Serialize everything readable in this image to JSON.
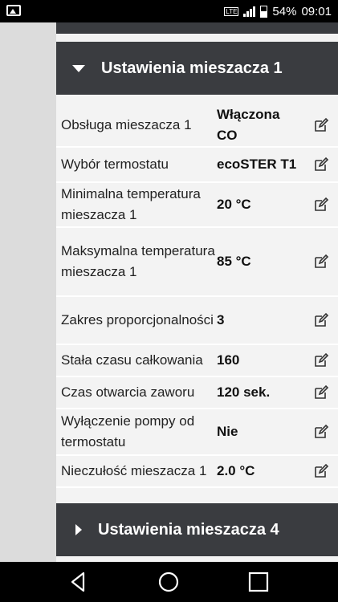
{
  "status_bar": {
    "network": "LTE",
    "battery": "54%",
    "time": "09:01",
    "icons": [
      "image-notification-icon",
      "signal-icon",
      "battery-icon"
    ]
  },
  "section1": {
    "title": "Ustawienia mieszacza 1",
    "expanded": true
  },
  "rows": [
    {
      "label": "Obsługa mieszacza 1",
      "value": "Włączona CO"
    },
    {
      "label": "Wybór termostatu",
      "value": "ecoSTER T1"
    },
    {
      "label": "Minimalna temperatura mieszacza 1",
      "value": "20 °C"
    },
    {
      "label": "Maksymalna temperatura mieszacza 1",
      "value": "85 °C"
    },
    {
      "label": "Zakres proporcjonalności",
      "value": "3"
    },
    {
      "label": "Stała czasu całkowania",
      "value": "160"
    },
    {
      "label": "Czas otwarcia zaworu",
      "value": "120 sek."
    },
    {
      "label": "Wyłączenie pompy od termostatu",
      "value": "Nie"
    },
    {
      "label": "Nieczułość mieszacza 1",
      "value": "2.0 °C"
    }
  ],
  "section4": {
    "title": "Ustawienia mieszacza 4",
    "expanded": false
  },
  "nav": {
    "icons": [
      "back-icon",
      "home-icon",
      "recents-icon"
    ]
  }
}
